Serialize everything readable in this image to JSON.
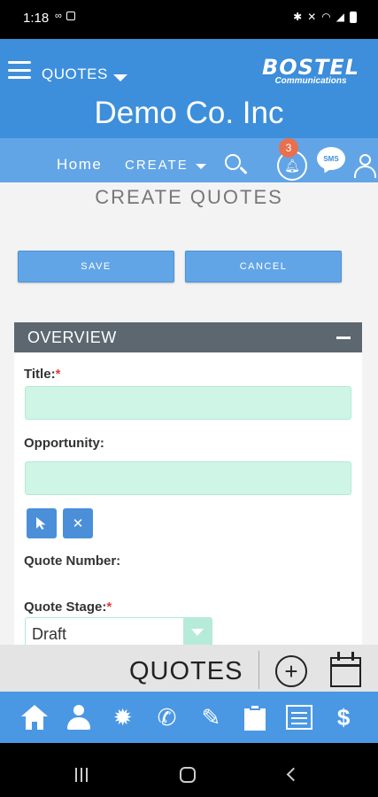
{
  "status_bar": {
    "time": "1:18",
    "left_icons": [
      "voicemail-icon",
      "gallery-icon"
    ],
    "right_icons": [
      "bluetooth-icon",
      "mute-icon",
      "wifi-icon",
      "signal-icon",
      "battery-icon"
    ]
  },
  "header": {
    "module_label": "QUOTES",
    "logo_text": "BOSTEL",
    "logo_subtext": "Communications",
    "company_name": "Demo Co. Inc"
  },
  "nav": {
    "home_label": "Home",
    "create_label": "CREATE",
    "notification_count": "3",
    "sms_label": "SMS"
  },
  "page": {
    "title": "CREATE QUOTES",
    "save_label": "SAVE",
    "cancel_label": "CANCEL"
  },
  "overview": {
    "header": "OVERVIEW",
    "title_label": "Title:",
    "title_value": "",
    "opportunity_label": "Opportunity:",
    "opportunity_value": "",
    "quote_number_label": "Quote Number:",
    "quote_stage_label": "Quote Stage:",
    "quote_stage_value": "Draft",
    "required_mark": "*"
  },
  "module_bar": {
    "title": "QUOTES",
    "add_symbol": "+"
  },
  "tab_bar": {
    "items": [
      "home-icon",
      "contacts-icon",
      "settings-icon",
      "phone-icon",
      "tasks-icon",
      "documents-icon",
      "calendar-icon",
      "dollar-icon"
    ],
    "phone_glyph": "✆",
    "settings_glyph": "✹",
    "tasks_glyph": "✎",
    "dollar_glyph": "$"
  },
  "colors": {
    "header_blue": "#3d8fdc",
    "nav_blue": "#62a5e6",
    "panel_header": "#5d6770",
    "input_mint": "#cff5e6",
    "badge": "#e8704f"
  }
}
